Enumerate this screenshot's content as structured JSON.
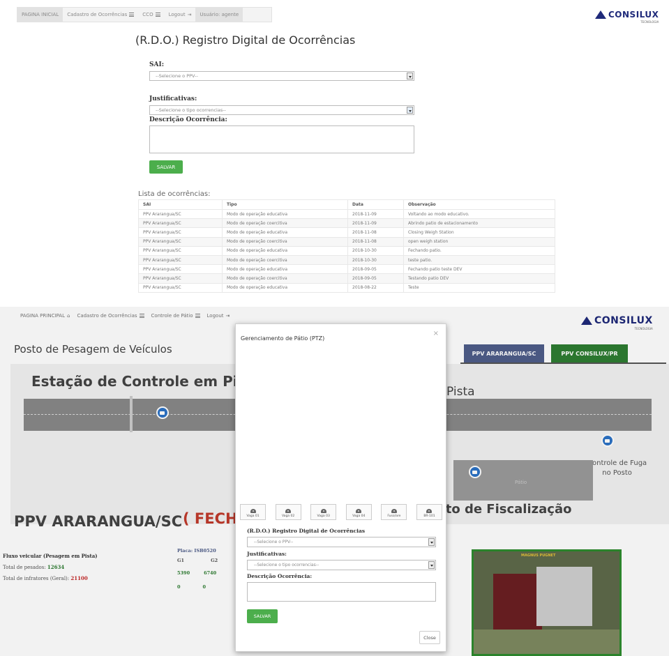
{
  "top": {
    "nav": {
      "home": "PAGINA INICIAL",
      "cadastro": "Cadastro de Ocorrências",
      "cco": "CCO",
      "logout": "Logout",
      "user": "Usuário: agente"
    },
    "logo": {
      "name": "CONSILUX",
      "tagline": "TECNOLOGIA"
    },
    "title": "(R.D.O.) Registro Digital de Ocorrências",
    "form": {
      "sai_label": "SAI:",
      "sai_placeholder": "--Selecione o PPV--",
      "just_label": "Justificativas:",
      "just_placeholder": "--Selecione o tipo ocorrencias--",
      "desc_label": "Descrição Ocorrência:",
      "save_label": "SALVAR"
    },
    "list_title": "Lista de ocorrências:",
    "table": {
      "headers": [
        "SAI",
        "Tipo",
        "Data",
        "Observação"
      ],
      "rows": [
        [
          "PPV Ararangua/SC",
          "Modo de operação educativa",
          "2018-11-09",
          "Voltando ao modo educativo."
        ],
        [
          "PPV Ararangua/SC",
          "Modo de operação coercitiva",
          "2018-11-09",
          "Abrindo patio de estacionamento"
        ],
        [
          "PPV Ararangua/SC",
          "Modo de operação educativa",
          "2018-11-08",
          "Closing Weigh Station"
        ],
        [
          "PPV Ararangua/SC",
          "Modo de operação coercitiva",
          "2018-11-08",
          "open weigh station"
        ],
        [
          "PPV Ararangua/SC",
          "Modo de operação educativa",
          "2018-10-30",
          "Fechando patio."
        ],
        [
          "PPV Ararangua/SC",
          "Modo de operação coercitiva",
          "2018-10-30",
          "teste patio."
        ],
        [
          "PPV Ararangua/SC",
          "Modo de operação educativa",
          "2018-09-05",
          "Fechando patio teste DEV"
        ],
        [
          "PPV Ararangua/SC",
          "Modo de operação coercitiva",
          "2018-09-05",
          "Testando patio DEV"
        ],
        [
          "PPV Ararangua/SC",
          "Modo de operação educativa",
          "2018-08-22",
          "Teste"
        ]
      ]
    }
  },
  "bottom": {
    "nav": {
      "home": "PAGINA PRINCIPAL",
      "cadastro": "Cadastro de Ocorrências",
      "controle": "Controle de Pátio",
      "logout": "Logout"
    },
    "logo": {
      "name": "CONSILUX",
      "tagline": "TECNOLOGIA"
    },
    "posto_title": "Posto de Pesagem de Veículos",
    "tabs": [
      {
        "label": "PPV ARARANGUA/SC",
        "color": "#4f5d8a"
      },
      {
        "label": "PPV CONSILUX/PR",
        "color": "#2e7d32"
      }
    ],
    "estacao_title": "Estação de Controle em Pista",
    "pista_fragment": "Pista",
    "fuga_label": [
      "Controle de Fuga",
      "no Posto"
    ],
    "patio_label": "Pátio",
    "fiscalizacao": "sto de Fiscalização",
    "ppv_name": "PPV ARARANGUA/SC",
    "status": "( FECHA",
    "flow": {
      "title": "Fluxo veicular (Pesagem em Pista)",
      "pesados_label": "Total de pesados:",
      "pesados_value": "12634",
      "infratores_label": "Total de infratores (Geral):",
      "infratores_value": "21100"
    },
    "grid": {
      "header": "Placa: ISB0520",
      "cols": [
        "G1",
        "G2"
      ],
      "row1": [
        "5390",
        "6740"
      ],
      "row2": [
        "0",
        "0"
      ]
    },
    "cam_caption": "MAGNUS PUGNET"
  },
  "modal": {
    "title": "Gerenciamento de Pátio (PTZ)",
    "close_x": "×",
    "cameras": [
      "Vaga 01",
      "Vaga 02",
      "Vaga 03",
      "Vaga 04",
      "Fuso/are",
      "BR-101"
    ],
    "rdo_title": "(R.D.O.) Registro Digital de Ocorrências",
    "sai_placeholder": "--Selecione o PPV--",
    "just_label": "Justificativas:",
    "just_placeholder": "--Selecione o tipo ocorrencias--",
    "desc_label": "Descrição Ocorrência:",
    "save_label": "SALVAR",
    "close_label": "Close"
  }
}
